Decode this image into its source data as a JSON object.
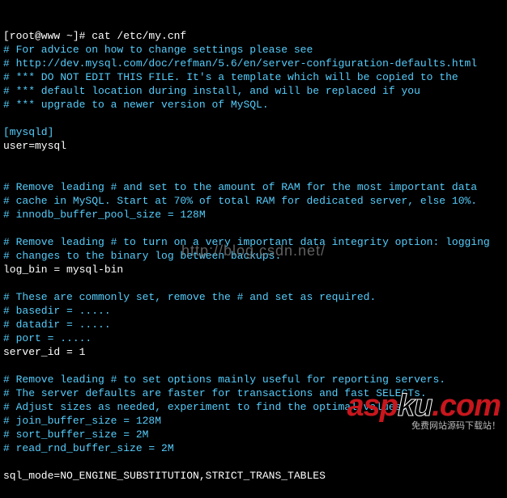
{
  "prompt": "[root@www ~]# ",
  "command": "cat /etc/my.cnf",
  "lines": [
    {
      "cls": "comment",
      "text": "# For advice on how to change settings please see"
    },
    {
      "cls": "comment",
      "text": "# http://dev.mysql.com/doc/refman/5.6/en/server-configuration-defaults.html"
    },
    {
      "cls": "comment",
      "text": "# *** DO NOT EDIT THIS FILE. It's a template which will be copied to the"
    },
    {
      "cls": "comment",
      "text": "# *** default location during install, and will be replaced if you"
    },
    {
      "cls": "comment",
      "text": "# *** upgrade to a newer version of MySQL."
    },
    {
      "cls": "",
      "text": ""
    },
    {
      "cls": "section",
      "text": "[mysqld]"
    },
    {
      "cls": "",
      "text": "user=mysql"
    },
    {
      "cls": "",
      "text": ""
    },
    {
      "cls": "",
      "text": ""
    },
    {
      "cls": "comment",
      "text": "# Remove leading # and set to the amount of RAM for the most important data"
    },
    {
      "cls": "comment",
      "text": "# cache in MySQL. Start at 70% of total RAM for dedicated server, else 10%."
    },
    {
      "cls": "comment",
      "text": "# innodb_buffer_pool_size = 128M"
    },
    {
      "cls": "",
      "text": ""
    },
    {
      "cls": "comment",
      "text": "# Remove leading # to turn on a very important data integrity option: logging"
    },
    {
      "cls": "comment",
      "text": "# changes to the binary log between backups."
    },
    {
      "cls": "",
      "text": "log_bin = mysql-bin"
    },
    {
      "cls": "",
      "text": ""
    },
    {
      "cls": "comment",
      "text": "# These are commonly set, remove the # and set as required."
    },
    {
      "cls": "comment",
      "text": "# basedir = ....."
    },
    {
      "cls": "comment",
      "text": "# datadir = ....."
    },
    {
      "cls": "comment",
      "text": "# port = ....."
    },
    {
      "cls": "",
      "text": "server_id = 1"
    },
    {
      "cls": "",
      "text": ""
    },
    {
      "cls": "comment",
      "text": "# Remove leading # to set options mainly useful for reporting servers."
    },
    {
      "cls": "comment",
      "text": "# The server defaults are faster for transactions and fast SELECTs."
    },
    {
      "cls": "comment",
      "text": "# Adjust sizes as needed, experiment to find the optimal values."
    },
    {
      "cls": "comment",
      "text": "# join_buffer_size = 128M"
    },
    {
      "cls": "comment",
      "text": "# sort_buffer_size = 2M"
    },
    {
      "cls": "comment",
      "text": "# read_rnd_buffer_size = 2M"
    },
    {
      "cls": "",
      "text": ""
    },
    {
      "cls": "",
      "text": "sql_mode=NO_ENGINE_SUBSTITUTION,STRICT_TRANS_TABLES"
    }
  ],
  "watermark": "http://blog.csdn.net/",
  "logo": {
    "left": "asp",
    "mid": "ku",
    "right": ".com"
  },
  "tagline": "免费网站源码下载站！"
}
